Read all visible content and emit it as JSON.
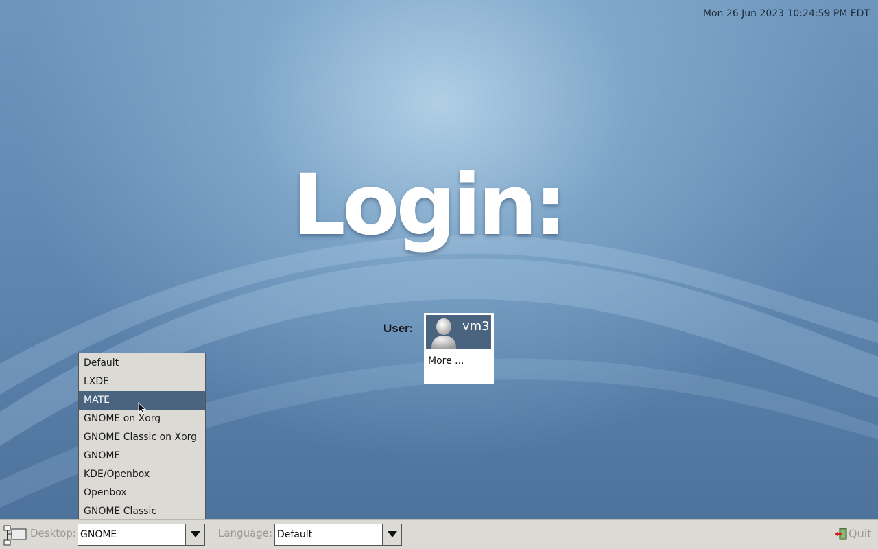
{
  "clock": "Mon 26 Jun 2023 10:24:59 PM EDT",
  "title": "Login:",
  "user_label": "User:",
  "users": [
    {
      "name": "vm3",
      "icon": "user-avatar-icon"
    }
  ],
  "more_text": "More ...",
  "desktop_menu": {
    "items": [
      {
        "label": "Default"
      },
      {
        "label": "LXDE"
      },
      {
        "label": "MATE"
      },
      {
        "label": "GNOME on Xorg"
      },
      {
        "label": "GNOME Classic on Xorg"
      },
      {
        "label": "GNOME"
      },
      {
        "label": "KDE/Openbox"
      },
      {
        "label": "Openbox"
      },
      {
        "label": "GNOME Classic"
      }
    ],
    "highlighted": "MATE"
  },
  "bottom_bar": {
    "menu_icon": "session-menu-icon",
    "desktop_label": "Desktop:",
    "desktop_value": "GNOME",
    "language_label": "Language:",
    "language_value": "Default",
    "quit_label": "Quit",
    "quit_icon": "exit-door-icon"
  },
  "colors": {
    "selection": "#4a6480",
    "bar": "#dcdad5",
    "background": "#5c84ad"
  }
}
